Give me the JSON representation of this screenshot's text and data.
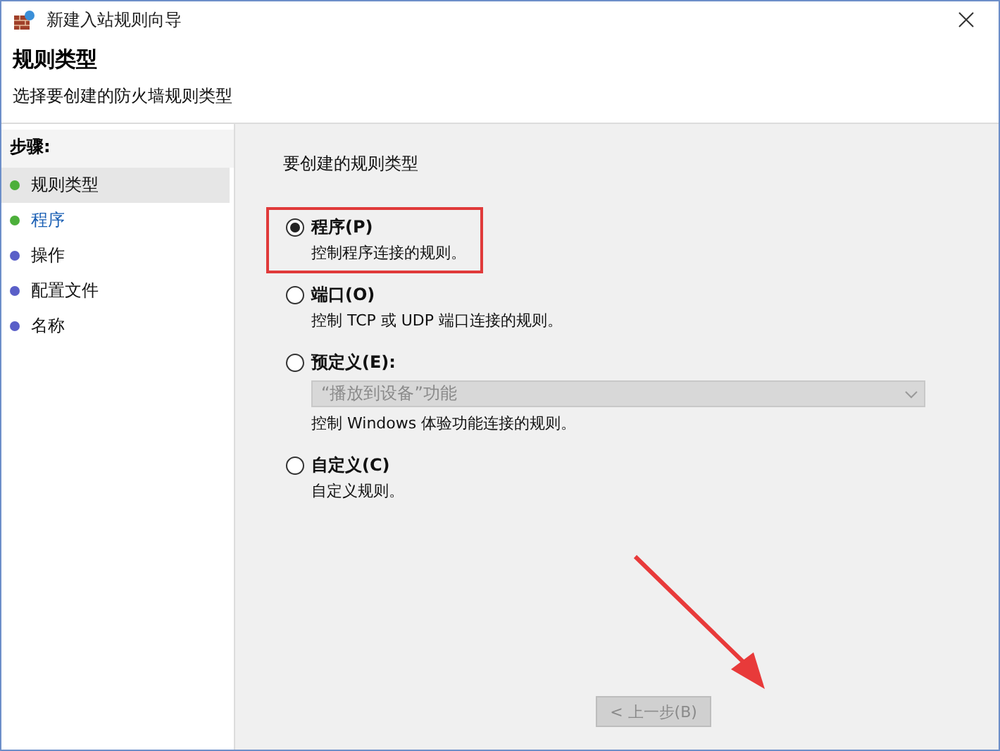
{
  "window": {
    "title": "新建入站规则向导"
  },
  "header": {
    "title": "规则类型",
    "subtitle": "选择要创建的防火墙规则类型"
  },
  "steps": {
    "heading": "步骤:",
    "items": [
      {
        "label": "规则类型",
        "selected": true,
        "kind": "plain",
        "color": "#4caf3a"
      },
      {
        "label": "程序",
        "selected": false,
        "kind": "link",
        "color": "#4caf3a"
      },
      {
        "label": "操作",
        "selected": false,
        "kind": "plain",
        "color": "#5a5fc8"
      },
      {
        "label": "配置文件",
        "selected": false,
        "kind": "plain",
        "color": "#5a5fc8"
      },
      {
        "label": "名称",
        "selected": false,
        "kind": "plain",
        "color": "#5a5fc8"
      }
    ]
  },
  "content": {
    "prompt": "要创建的规则类型",
    "options": [
      {
        "label": "程序(P)",
        "description": "控制程序连接的规则。",
        "selected": true,
        "highlighted": true
      },
      {
        "label": "端口(O)",
        "description": "控制 TCP 或 UDP 端口连接的规则。",
        "selected": false,
        "highlighted": false
      },
      {
        "label": "预定义(E):",
        "description": "控制 Windows 体验功能连接的规则。",
        "selected": false,
        "highlighted": false,
        "dropdown": {
          "value": "“播放到设备”功能",
          "disabled": true
        }
      },
      {
        "label": "自定义(C)",
        "description": "自定义规则。",
        "selected": false,
        "highlighted": false
      }
    ]
  },
  "buttons": [
    {
      "label": "< 上一步(B)",
      "disabled": true
    }
  ]
}
